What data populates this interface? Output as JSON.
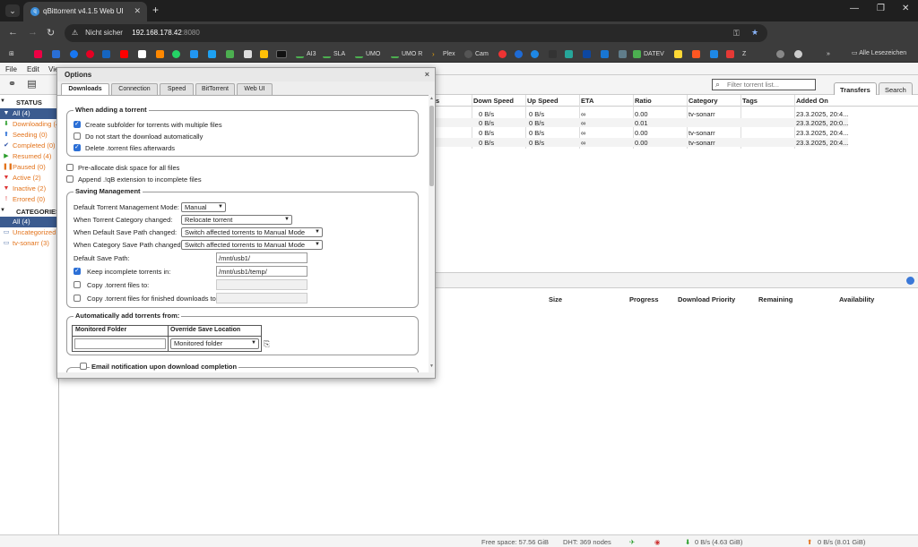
{
  "browser": {
    "tab_title": "qBittorrent v4.1.5 Web UI",
    "security_label": "Nicht sicher",
    "url_host": "192.168.178.42",
    "url_port": ":8080",
    "bookmarks": [
      "AI3",
      "SLA",
      "UMO",
      "UMO R",
      "Plex",
      "Cam",
      "DATEV"
    ],
    "all_bookmarks": "Alle Lesezeichen"
  },
  "menu": {
    "file": "File",
    "edit": "Edit",
    "view": "Vie"
  },
  "search": {
    "placeholder": "Filter torrent list..."
  },
  "top_tabs": {
    "transfers": "Transfers",
    "search": "Search"
  },
  "sidebar": {
    "status_header": "STATUS",
    "status_items": [
      "All (4)",
      "Downloading (4",
      "Seeding (0)",
      "Completed (0)",
      "Resumed (4)",
      "Paused (0)",
      "Active (2)",
      "Inactive (2)",
      "Errored (0)"
    ],
    "categories_header": "CATEGORIES",
    "category_items": [
      "All (4)",
      "Uncategorized (1",
      "tv-sonarr (3)"
    ]
  },
  "torrent_table": {
    "columns": [
      "s",
      "Down Speed",
      "Up Speed",
      "ETA",
      "Ratio",
      "Category",
      "Tags",
      "Added On"
    ],
    "rows": [
      {
        "down": "0 B/s",
        "up": "0 B/s",
        "eta": "∞",
        "ratio": "0.00",
        "category": "tv-sonarr",
        "added": "23.3.2025, 20:4..."
      },
      {
        "down": "0 B/s",
        "up": "0 B/s",
        "eta": "∞",
        "ratio": "0.01",
        "category": "",
        "added": "23.3.2025, 20:0..."
      },
      {
        "down": "0 B/s",
        "up": "0 B/s",
        "eta": "∞",
        "ratio": "0.00",
        "category": "tv-sonarr",
        "added": "23.3.2025, 20:4..."
      },
      {
        "down": "0 B/s",
        "up": "0 B/s",
        "eta": "∞",
        "ratio": "0.00",
        "category": "tv-sonarr",
        "added": "23.3.2025, 20:4..."
      }
    ]
  },
  "files_table": {
    "columns": [
      "Size",
      "Progress",
      "Download Priority",
      "Remaining",
      "Availability"
    ]
  },
  "statusbar": {
    "free_space": "Free space: 57.56 GiB",
    "dht": "DHT: 369 nodes",
    "down": "0 B/s (4.63 GiB)",
    "up": "0 B/s (8.01 GiB)"
  },
  "dialog": {
    "title": "Options",
    "close": "×",
    "tabs": [
      "Downloads",
      "Connection",
      "Speed",
      "BitTorrent",
      "Web UI"
    ],
    "adding": {
      "legend": "When adding a torrent",
      "create_subfolder": "Create subfolder for torrents with multiple files",
      "no_autostart": "Do not start the download automatically",
      "delete_torrent": "Delete .torrent files afterwards"
    },
    "preallocate": "Pre-allocate disk space for all files",
    "append_ext": "Append .!qB extension to incomplete files",
    "saving": {
      "legend": "Saving Management",
      "mode_label": "Default Torrent Management Mode:",
      "mode_value": "Manual",
      "cat_changed_label": "When Torrent Category changed:",
      "cat_changed_value": "Relocate torrent",
      "default_path_changed_label": "When Default Save Path changed:",
      "default_path_changed_value": "Switch affected torrents to Manual Mode",
      "cat_path_changed_label": "When Category Save Path changed:",
      "cat_path_changed_value": "Switch affected torrents to Manual Mode",
      "save_path_label": "Default Save Path:",
      "save_path_value": "/mnt/usb1/",
      "incomplete_label": "Keep incomplete torrents in:",
      "incomplete_value": "/mnt/usb1/temp/",
      "copy_label": "Copy .torrent files to:",
      "copy_finished_label": "Copy .torrent files for finished downloads to:"
    },
    "auto_add": {
      "legend": "Automatically add torrents from:",
      "col_folder": "Monitored Folder",
      "col_override": "Override Save Location",
      "override_value": "Monitored folder"
    },
    "email_legend": "Email notification upon download completion"
  }
}
